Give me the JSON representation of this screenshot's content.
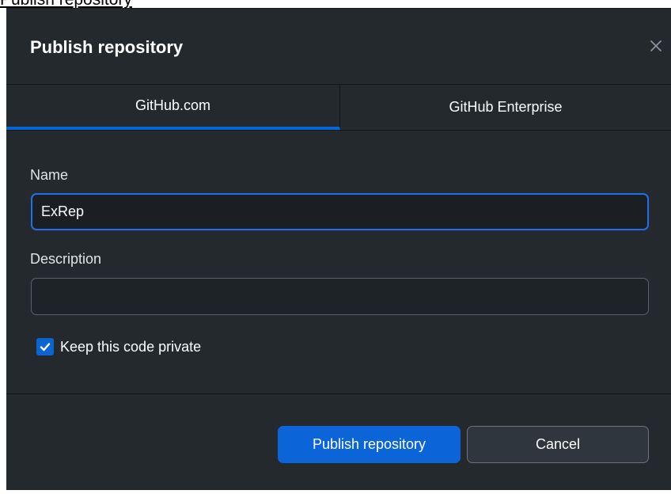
{
  "page": {
    "top_text": "Publish repository"
  },
  "dialog": {
    "title": "Publish repository",
    "close_icon": "close-icon"
  },
  "tabs": [
    {
      "label": "GitHub.com",
      "selected": true
    },
    {
      "label": "GitHub Enterprise",
      "selected": false
    }
  ],
  "form": {
    "name_label": "Name",
    "name_value": "ExRep",
    "description_label": "Description",
    "description_value": "",
    "private_label": "Keep this code private",
    "private_checked": true
  },
  "buttons": {
    "publish_label": "Publish repository",
    "cancel_label": "Cancel"
  },
  "colors": {
    "dialog_bg": "#24292e",
    "accent": "#0366d6",
    "primary_button": "#0b65d8"
  }
}
